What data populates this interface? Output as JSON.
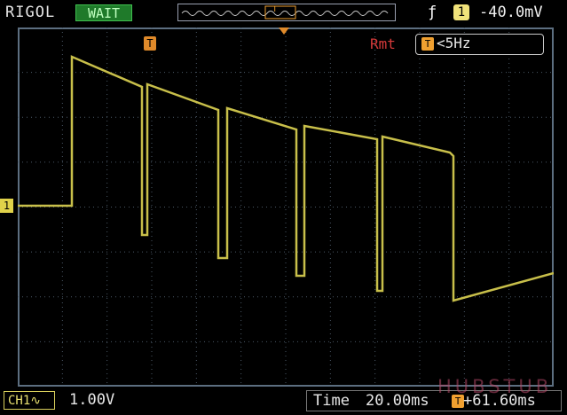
{
  "header": {
    "brand": "RIGOL",
    "status": "WAIT",
    "trigger_edge_icon": "rising-edge-icon",
    "trigger_source": "1",
    "trigger_level": "-40.0mV"
  },
  "screen": {
    "remote_label": "Rmt",
    "freq_icon_label": "T",
    "freq_text": "<5Hz",
    "trigger_pos_marker": "T",
    "ch1_marker": "1"
  },
  "footer": {
    "channel": "CH1",
    "volts_per_div": "1.00V",
    "time_label": "Time",
    "time_per_div": "20.00ms",
    "trigger_pos_icon": "T",
    "trigger_offset": "+61.60ms"
  },
  "watermark": "HUBSTUB",
  "colors": {
    "trace": "#c8bf4a",
    "grid": "#4a5866",
    "status_bg": "#1f7a2a",
    "remote": "#d43a3a"
  }
}
